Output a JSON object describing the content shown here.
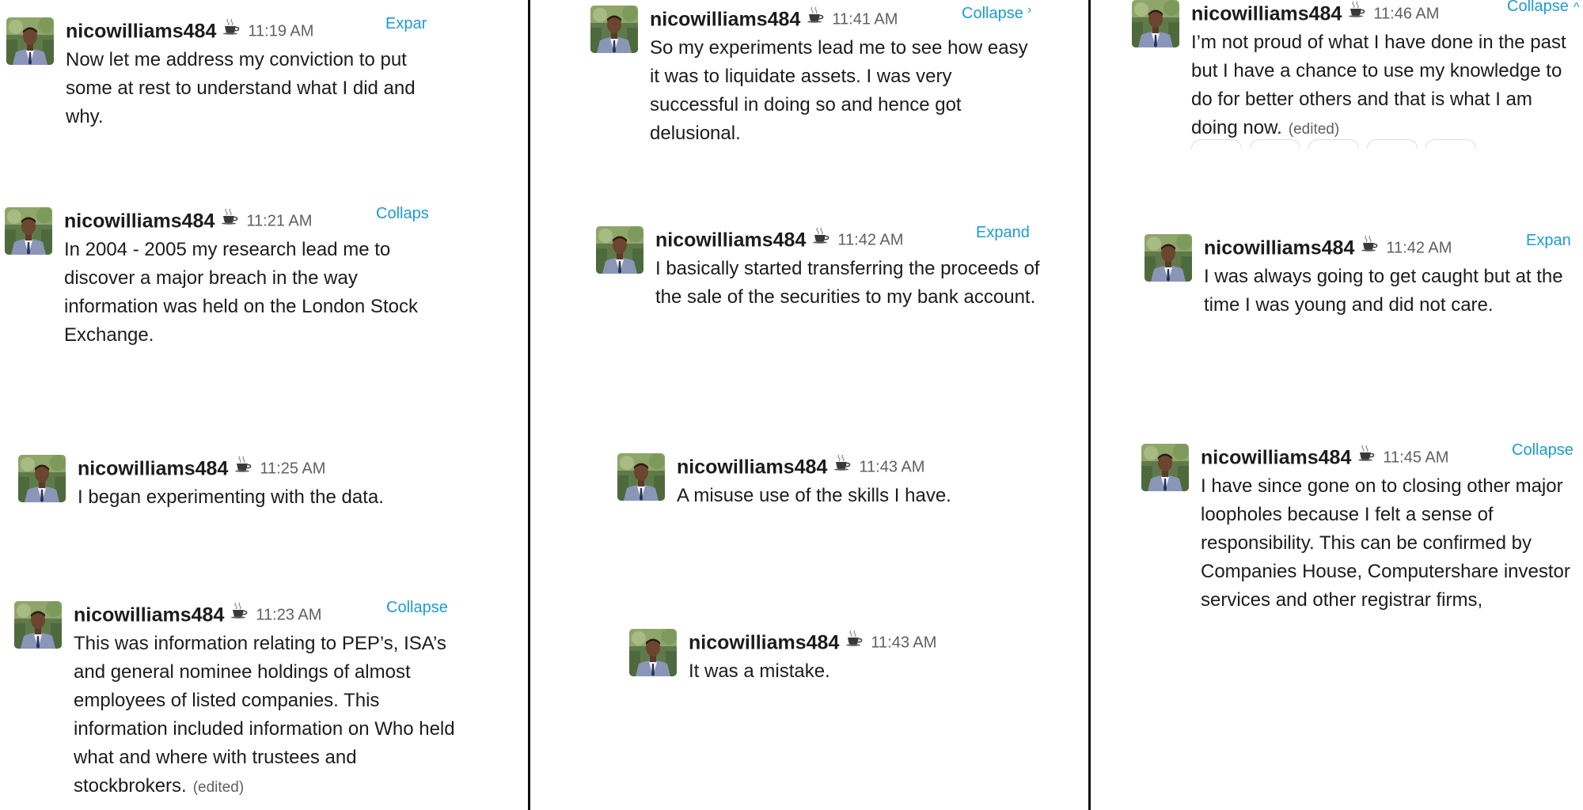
{
  "colors": {
    "link": "#1d9bd1",
    "text": "#1d1c1d",
    "muted": "#616061",
    "divider": "#111111"
  },
  "user": {
    "name": "nicowilliams484",
    "status_icon": "coffee-icon"
  },
  "columns": [
    {
      "messages": [
        {
          "time": "11:19 AM",
          "action": "Expar",
          "text": "Now let me address my conviction to put some at rest to understand what I did and why.",
          "edited": ""
        },
        {
          "time": "11:21 AM",
          "action": "Collaps",
          "text": "In 2004 - 2005 my research lead me to discover a major breach in the way information was held on the London Stock Exchange.",
          "edited": ""
        },
        {
          "time": "11:25 AM",
          "action": "",
          "text": "I began experimenting with the data.",
          "edited": ""
        },
        {
          "time": "11:23 AM",
          "action": "Collapse",
          "text": "This was information relating to PEP’s, ISA’s and general nominee holdings of almost employees of listed  companies. This information included information on Who held what and where with trustees and stockbrokers.",
          "edited": "(edited)"
        }
      ]
    },
    {
      "messages": [
        {
          "time": "11:41 AM",
          "action": "Collapse",
          "text": "So my experiments lead me to see how easy it was to liquidate assets. I was very successful in doing so and hence got delusional.",
          "edited": ""
        },
        {
          "time": "11:42 AM",
          "action": "Expand",
          "text": "I basically started transferring the proceeds of the sale of the securities to my bank account.",
          "edited": ""
        },
        {
          "time": "11:43 AM",
          "action": "",
          "text": "A misuse use of the skills I have.",
          "edited": ""
        },
        {
          "time": "11:43 AM",
          "action": "",
          "text": "It was a mistake.",
          "edited": ""
        }
      ]
    },
    {
      "messages": [
        {
          "time": "11:46 AM",
          "action": "Collapse",
          "text": "I’m not proud of what I have done in the past but I have a chance to use my knowledge to do for better others and that is what I am doing now.",
          "edited": "(edited)"
        },
        {
          "time": "11:42 AM",
          "action": "Expan",
          "text": "I was always going to get caught but at the time I was young and did not care.",
          "edited": ""
        },
        {
          "time": "11:45 AM",
          "action": "Collapse",
          "text": "I have since gone on to closing other major loopholes because I felt a sense of responsibility. This can be confirmed by Companies House, Computershare investor services and other registrar firms,",
          "edited": ""
        }
      ]
    }
  ]
}
